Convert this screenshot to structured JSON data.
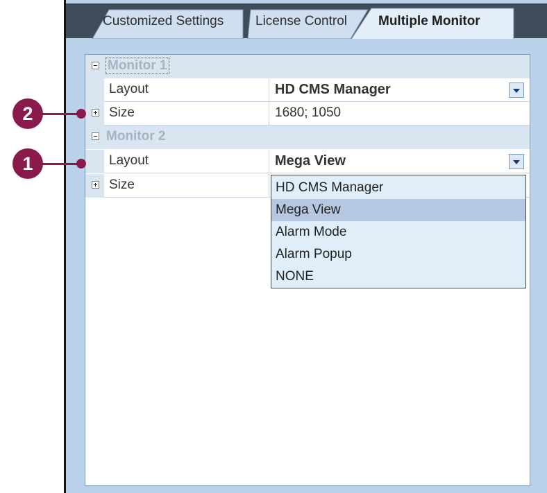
{
  "tabs": [
    {
      "label": "Customized Settings",
      "active": false
    },
    {
      "label": "License Control",
      "active": false
    },
    {
      "label": "Multiple Monitor",
      "active": true
    }
  ],
  "grid": {
    "monitor1": {
      "title": "Monitor 1",
      "layout_label": "Layout",
      "layout_value": "HD CMS Manager",
      "size_label": "Size",
      "size_value": "1680; 1050"
    },
    "monitor2": {
      "title": "Monitor 2",
      "layout_label": "Layout",
      "layout_value": "Mega View",
      "size_label": "Size"
    }
  },
  "dropdown": {
    "options": [
      "HD CMS Manager",
      "Mega View",
      "Alarm Mode",
      "Alarm Popup",
      "NONE"
    ],
    "selected": "Mega View"
  },
  "callouts": [
    "2",
    "1"
  ],
  "colors": {
    "accent": "#8a1a4c",
    "frame": "#b9d1ea",
    "tab_shadow": "#3f4d5b",
    "selection": "#b5c7e1"
  },
  "icons": [
    "collapse-icon",
    "expand-icon",
    "dropdown-arrow-icon"
  ]
}
